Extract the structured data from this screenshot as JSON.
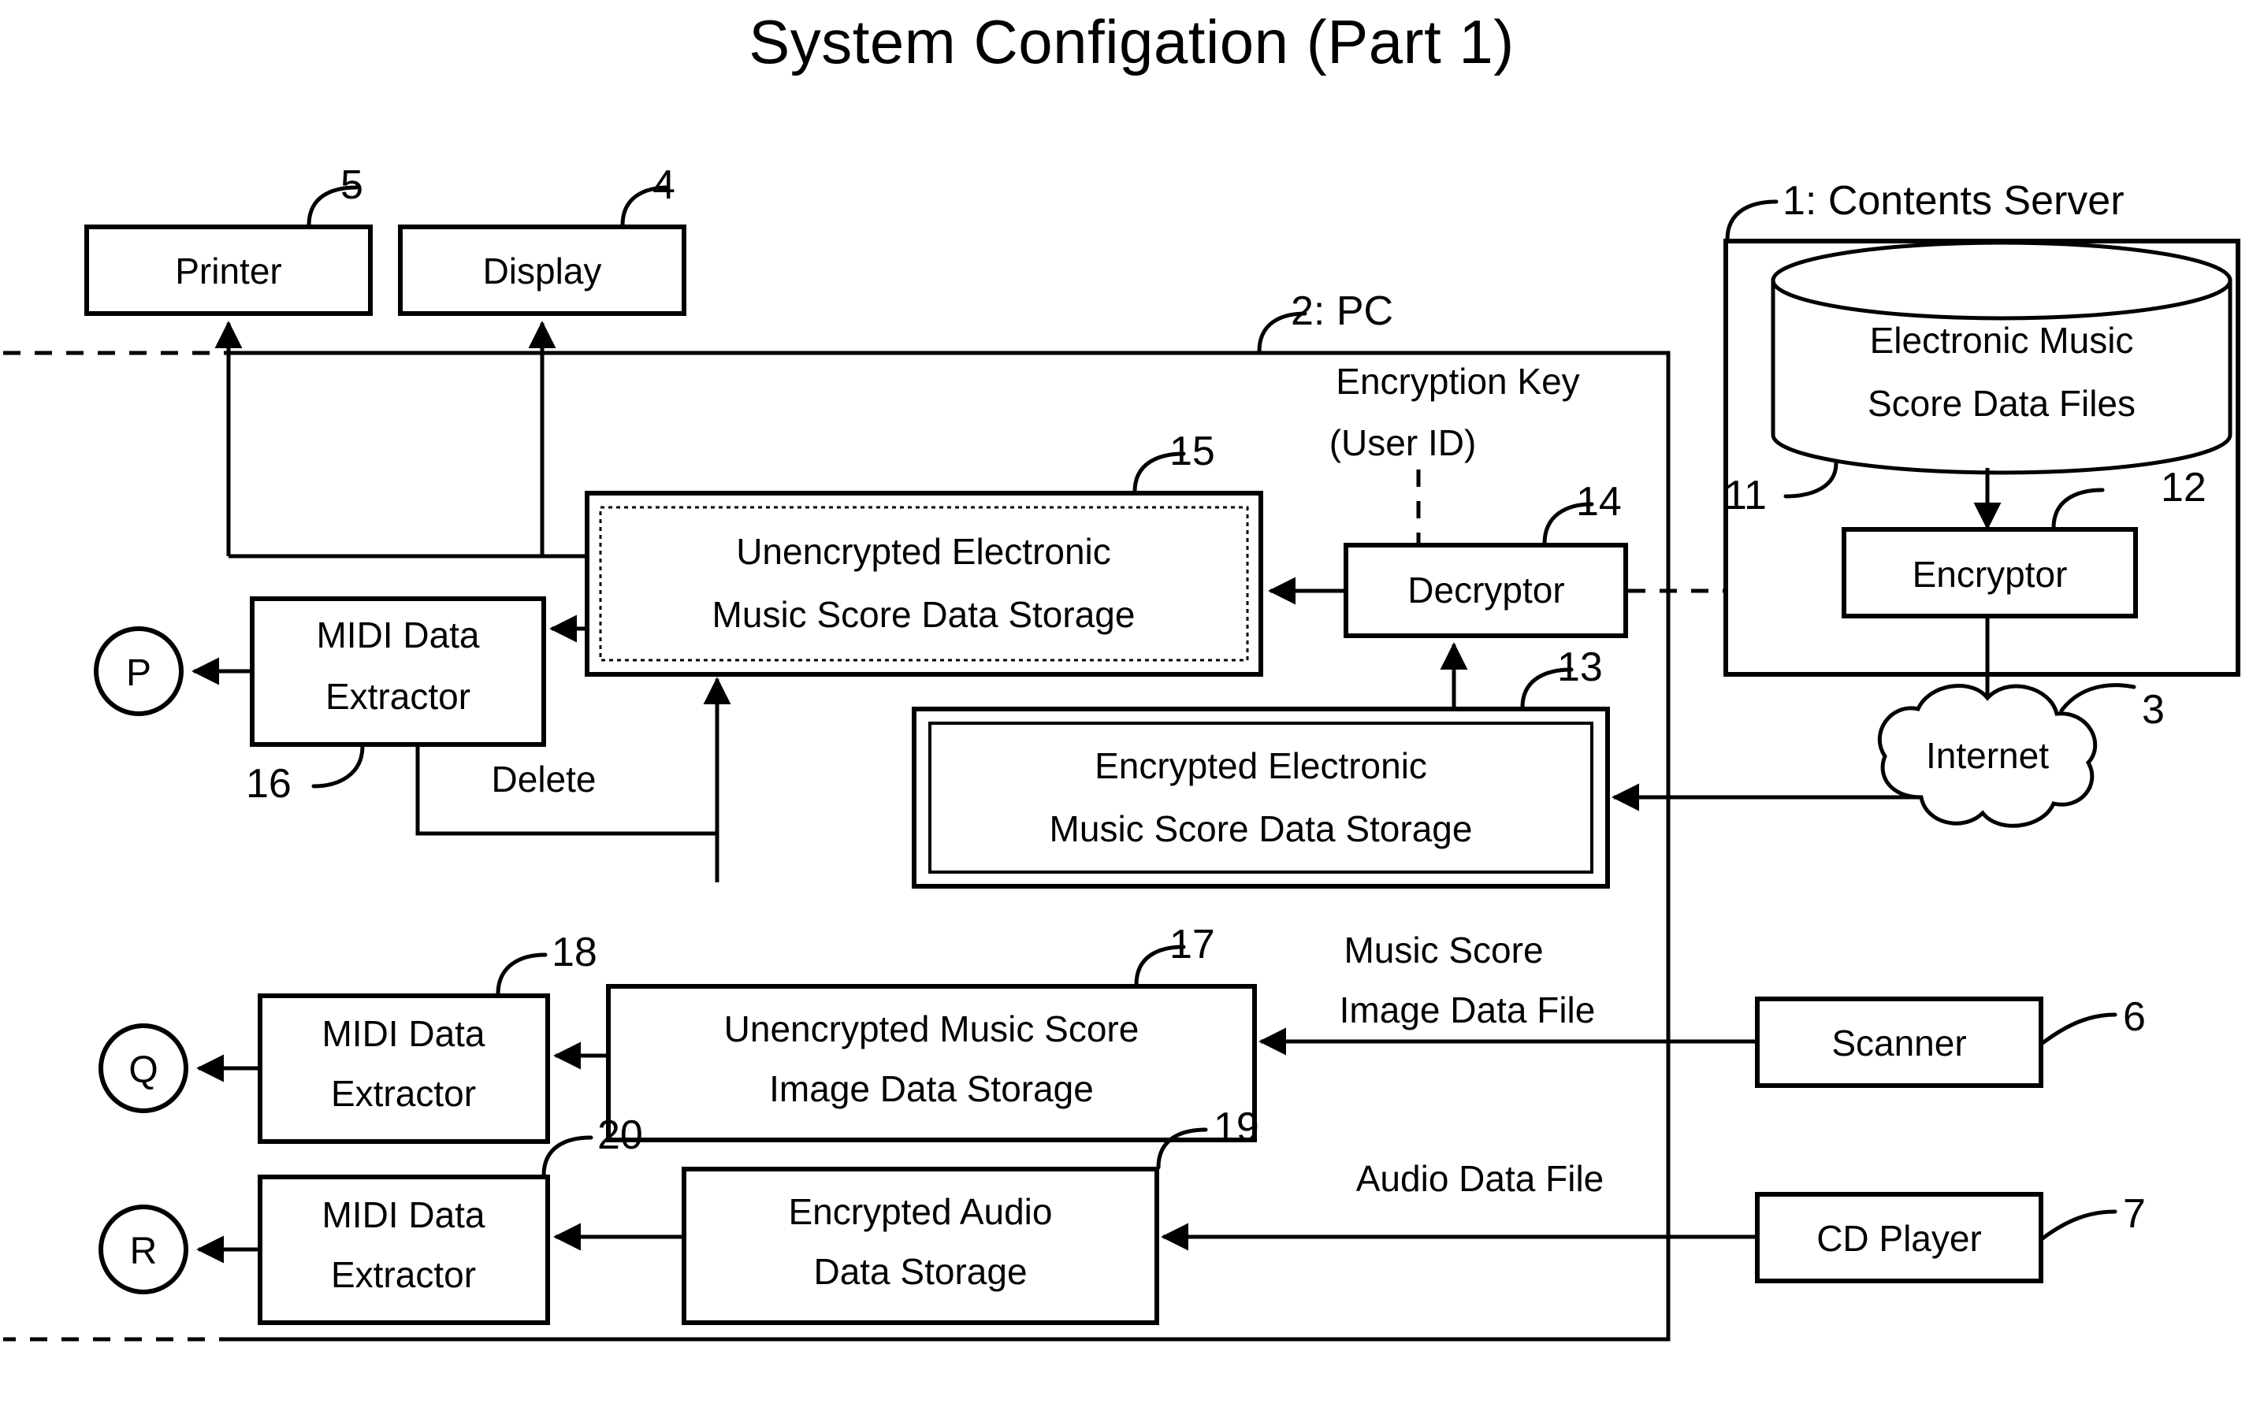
{
  "title": "System Configation (Part 1)",
  "nodes": {
    "printer": {
      "label": "Printer",
      "ref": "5"
    },
    "display": {
      "label": "Display",
      "ref": "4"
    },
    "contents_server": {
      "label": "1: Contents Server",
      "ref": "1"
    },
    "score_files": {
      "label_line1": "Electronic Music",
      "label_line2": "Score Data Files",
      "ref": "11"
    },
    "encryptor": {
      "label": "Encryptor",
      "ref": "12"
    },
    "internet": {
      "label": "Internet",
      "ref": "3"
    },
    "pc": {
      "label": "2: PC",
      "ref": "2"
    },
    "encryption_key": {
      "label_line1": "Encryption Key",
      "label_line2": "(User ID)"
    },
    "decryptor": {
      "label": "Decryptor",
      "ref": "14"
    },
    "unencrypted_score_storage": {
      "label_line1": "Unencrypted Electronic",
      "label_line2": "Music Score Data Storage",
      "ref": "15"
    },
    "encrypted_score_storage": {
      "label_line1": "Encrypted Electronic",
      "label_line2": "Music Score Data Storage",
      "ref": "13"
    },
    "midi_extractor_p": {
      "label_line1": "MIDI Data",
      "label_line2": "Extractor",
      "ref": "16"
    },
    "midi_extractor_q": {
      "label_line1": "MIDI Data",
      "label_line2": "Extractor",
      "ref": "18"
    },
    "midi_extractor_r": {
      "label_line1": "MIDI Data",
      "label_line2": "Extractor",
      "ref": "20"
    },
    "unencrypted_image_storage": {
      "label_line1": "Unencrypted Music Score",
      "label_line2": "Image Data Storage",
      "ref": "17"
    },
    "encrypted_audio_storage": {
      "label_line1": "Encrypted Audio",
      "label_line2": "Data Storage",
      "ref": "19"
    },
    "scanner": {
      "label": "Scanner",
      "ref": "6"
    },
    "cd_player": {
      "label": "CD Player",
      "ref": "7"
    },
    "terminal_p": {
      "label": "P"
    },
    "terminal_q": {
      "label": "Q"
    },
    "terminal_r": {
      "label": "R"
    }
  },
  "edge_labels": {
    "delete": "Delete",
    "music_score_image_file_line1": "Music Score",
    "music_score_image_file_line2": "Image Data File",
    "audio_data_file": "Audio Data File"
  },
  "colors": {
    "ink": "#000000",
    "paper": "#ffffff"
  }
}
